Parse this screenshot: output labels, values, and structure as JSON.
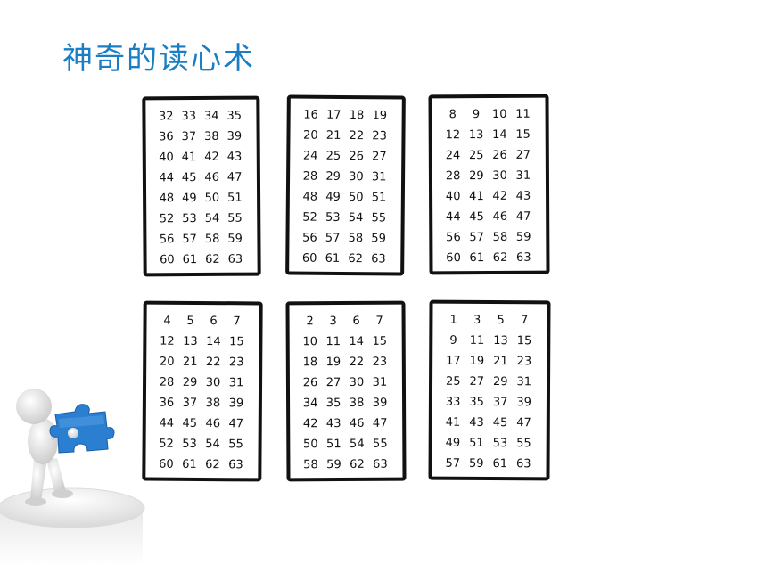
{
  "title": "神奇的读心术",
  "cards": [
    {
      "numbers": [
        "32",
        "33",
        "34",
        "35",
        "36",
        "37",
        "38",
        "39",
        "40",
        "41",
        "42",
        "43",
        "44",
        "45",
        "46",
        "47",
        "48",
        "49",
        "50",
        "51",
        "52",
        "53",
        "54",
        "55",
        "56",
        "57",
        "58",
        "59",
        "60",
        "61",
        "62",
        "63"
      ]
    },
    {
      "numbers": [
        "16",
        "17",
        "18",
        "19",
        "20",
        "21",
        "22",
        "23",
        "24",
        "25",
        "26",
        "27",
        "28",
        "29",
        "30",
        "31",
        "48",
        "49",
        "50",
        "51",
        "52",
        "53",
        "54",
        "55",
        "56",
        "57",
        "58",
        "59",
        "60",
        "61",
        "62",
        "63"
      ]
    },
    {
      "numbers": [
        "8",
        "9",
        "10",
        "11",
        "12",
        "13",
        "14",
        "15",
        "24",
        "25",
        "26",
        "27",
        "28",
        "29",
        "30",
        "31",
        "40",
        "41",
        "42",
        "43",
        "44",
        "45",
        "46",
        "47",
        "56",
        "57",
        "58",
        "59",
        "60",
        "61",
        "62",
        "63"
      ]
    },
    {
      "numbers": [
        "4",
        "5",
        "6",
        "7",
        "12",
        "13",
        "14",
        "15",
        "20",
        "21",
        "22",
        "23",
        "28",
        "29",
        "30",
        "31",
        "36",
        "37",
        "38",
        "39",
        "44",
        "45",
        "46",
        "47",
        "52",
        "53",
        "54",
        "55",
        "60",
        "61",
        "62",
        "63"
      ]
    },
    {
      "numbers": [
        "2",
        "3",
        "6",
        "7",
        "10",
        "11",
        "14",
        "15",
        "18",
        "19",
        "22",
        "23",
        "26",
        "27",
        "30",
        "31",
        "34",
        "35",
        "38",
        "39",
        "42",
        "43",
        "46",
        "47",
        "50",
        "51",
        "54",
        "55",
        "58",
        "59",
        "62",
        "63"
      ]
    },
    {
      "numbers": [
        "1",
        "3",
        "5",
        "7",
        "9",
        "11",
        "13",
        "15",
        "17",
        "19",
        "21",
        "23",
        "25",
        "27",
        "29",
        "31",
        "33",
        "35",
        "37",
        "39",
        "41",
        "43",
        "45",
        "47",
        "49",
        "51",
        "53",
        "55",
        "57",
        "59",
        "61",
        "63"
      ]
    }
  ],
  "colors": {
    "title": "#1a7ec4",
    "puzzle_piece": "#2a7fd0",
    "card_border": "#111111"
  },
  "decoration": {
    "figure_icon": "person-holding-puzzle-piece-icon"
  }
}
